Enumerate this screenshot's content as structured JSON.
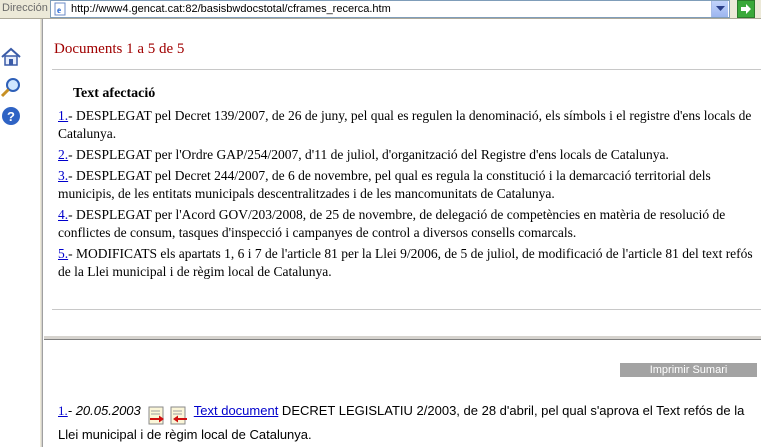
{
  "address_bar": {
    "label": "Dirección",
    "url": "http://www4.gencat.cat:82/basisbwdocstotal/cframes_recerca.htm"
  },
  "toolbar": {
    "icons": [
      "home-icon",
      "search-icon",
      "help-icon"
    ]
  },
  "results_header": {
    "count_text": "Documents 1 a 5 de 5"
  },
  "affectation": {
    "heading": "Text afectació",
    "entries": [
      {
        "num": "1.",
        "text": "- DESPLEGAT pel Decret 139/2007, de 26 de juny, pel qual es regulen la denominació, els símbols i el registre d'ens locals de Catalunya."
      },
      {
        "num": "2.",
        "text": "- DESPLEGAT per l'Ordre GAP/254/2007, d'11 de juliol, d'organització del Registre d'ens locals de Catalunya."
      },
      {
        "num": "3.",
        "text": "- DESPLEGAT pel Decret 244/2007, de 6 de novembre, pel qual es regula la constitució i la demarcació territorial dels municipis, de les entitats municipals descentralitzades i de les mancomunitats de Catalunya."
      },
      {
        "num": "4.",
        "text": "- DESPLEGAT per l'Acord GOV/203/2008, de 25 de novembre, de delegació de competències en matèria de resolució de conflictes de consum, tasques d'inspecció i campanyes de control a diversos consells comarcals."
      },
      {
        "num": "5.",
        "text": "- MODIFICATS els apartats 1, 6 i 7 de l'article 81 per la Llei 9/2006, de 5 de juliol, de modificació de l'article 81 del text refós de la Llei municipal i de règim local de Catalunya."
      }
    ]
  },
  "summary": {
    "print_label": "Imprimir Sumari",
    "result": {
      "num": "1.",
      "date": "- 20.05.2003",
      "link": "Text document",
      "text": " DECRET LEGISLATIU 2/2003, de 28 d'abril, pel qual s'aprova el Text refós de la Llei municipal i de règim local de Catalunya."
    }
  },
  "colors": {
    "count_text": "#a00000",
    "link": "#0000cc",
    "print_button": "#a3a3a3"
  }
}
